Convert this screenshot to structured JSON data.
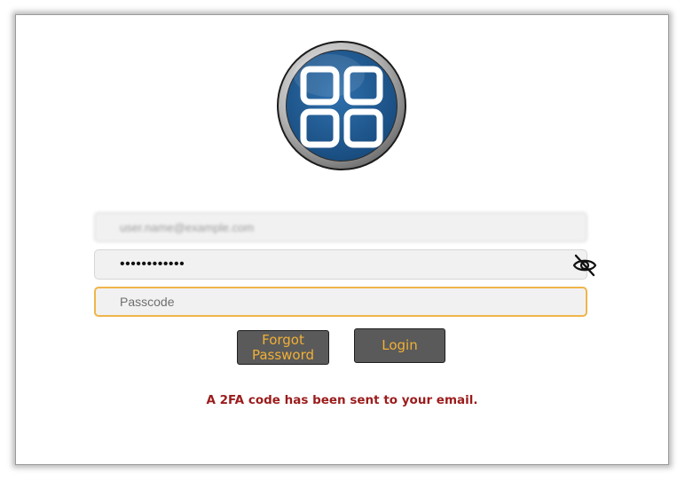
{
  "login": {
    "logo_icon": "grid-logo-icon",
    "email_value": "user.name@example.com",
    "password_value": "••••••••••••",
    "password_toggle_icon": "eye-slash-icon",
    "passcode_placeholder": "Passcode",
    "forgot_password_label": "Forgot Password",
    "login_label": "Login",
    "status_message": "A 2FA code has been sent to your email."
  },
  "colors": {
    "button_bg": "#5a5a5a",
    "button_text": "#f2b035",
    "focus_border": "#f0b54a",
    "message": "#9b1c1c",
    "logo_blue": "#215a92"
  }
}
